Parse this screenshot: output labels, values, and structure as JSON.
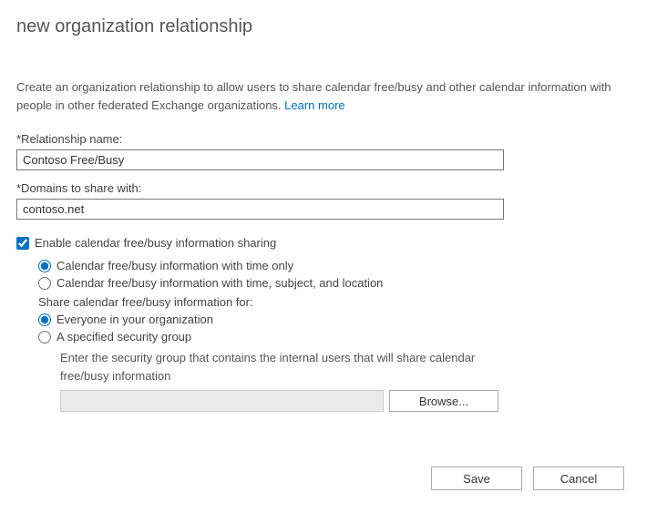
{
  "title": "new organization relationship",
  "intro": {
    "text": "Create an organization relationship to allow users to share calendar free/busy and other calendar information with people in other federated Exchange organizations. ",
    "link": "Learn more"
  },
  "fields": {
    "name_label": "*Relationship name:",
    "name_value": "Contoso Free/Busy",
    "domains_label": "*Domains to share with:",
    "domains_value": "contoso.net"
  },
  "sharing": {
    "enable_label": "Enable calendar free/busy information sharing",
    "level": {
      "time_only": "Calendar free/busy information with time only",
      "time_subject_location": "Calendar free/busy information with time, subject, and location"
    },
    "scope_label": "Share calendar free/busy information for:",
    "scope": {
      "everyone": "Everyone in your organization",
      "group": "A specified security group"
    },
    "group_hint": "Enter the security group that contains the internal users that will share calendar free/busy information",
    "group_value": "",
    "browse": "Browse..."
  },
  "footer": {
    "save": "Save",
    "cancel": "Cancel"
  }
}
